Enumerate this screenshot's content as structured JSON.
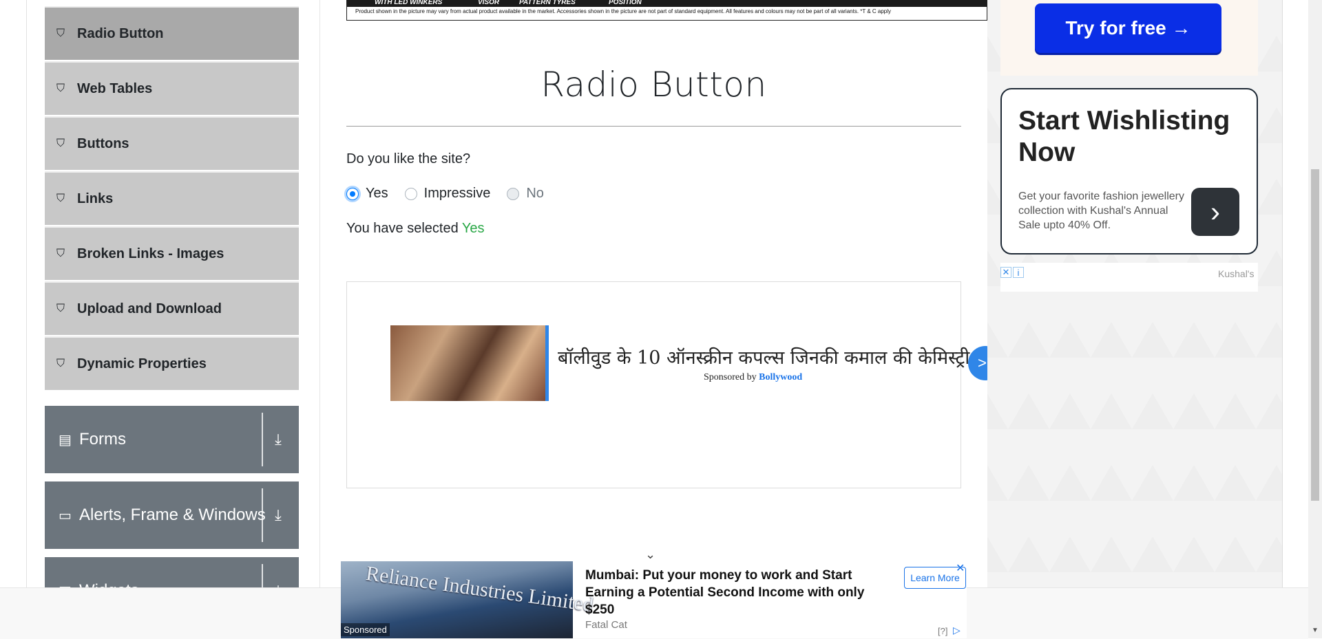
{
  "sidebar": {
    "items": [
      {
        "label": "Radio Button",
        "icon": "html5-icon"
      },
      {
        "label": "Web Tables",
        "icon": "html5-icon"
      },
      {
        "label": "Buttons",
        "icon": "html5-icon"
      },
      {
        "label": "Links",
        "icon": "html5-icon"
      },
      {
        "label": "Broken Links - Images",
        "icon": "html5-icon"
      },
      {
        "label": "Upload and Download",
        "icon": "html5-icon"
      },
      {
        "label": "Dynamic Properties",
        "icon": "html5-icon"
      }
    ],
    "active": "Radio Button",
    "groups": [
      {
        "label": "Forms",
        "icon": "document-icon"
      },
      {
        "label": "Alerts, Frame & Windows",
        "icon": "window-icon"
      },
      {
        "label": "Widgets",
        "icon": "widgets-icon"
      }
    ]
  },
  "banner": {
    "tags": [
      "WITH LED WINKERS",
      "VISOR",
      "PATTERN TYRES",
      "POSITION"
    ],
    "disclaimer": "Product shown in the picture may vary from actual product available in the market. Accessories shown in the picture are not part of standard equipment. All features and colours may not be part of all variants. *T & C apply"
  },
  "main": {
    "title": "Radio Button",
    "question": "Do you like the site?",
    "options": [
      {
        "label": "Yes",
        "checked": true,
        "disabled": false
      },
      {
        "label": "Impressive",
        "checked": false,
        "disabled": false
      },
      {
        "label": "No",
        "checked": false,
        "disabled": true
      }
    ],
    "result_prefix": "You have selected ",
    "result_value": "Yes"
  },
  "content_ad": {
    "headline": "बॉलीवुड के 10 ऑनस्क्रीन कपल्स जिनकी कमाल की केमिस्ट्री",
    "sponsored_by": "Sponsored by ",
    "sponsor": "Bollywood"
  },
  "right_ads": {
    "try_button": "Try for free →",
    "wish_title": "Start Wishlisting Now",
    "wish_sub": "Get your favorite fashion jewellery collection with Kushal's Annual Sale upto 40% Off.",
    "advertiser": "Kushal's"
  },
  "bottom_ad": {
    "photo_text": "Reliance Industries Limited",
    "sponsored": "Sponsored",
    "headline": "Mumbai: Put your money to work and Start Earning a Potential Second Income with only $250",
    "source": "Fatal Cat",
    "cta": "Learn More",
    "help": "[?]"
  },
  "colors": {
    "accent": "#007bff",
    "success": "#28a745",
    "group_bg": "#6c757d",
    "menu_bg": "#c8c8c8",
    "menu_active_bg": "#a9a9a9",
    "try_button_bg": "#0a2ee6"
  }
}
